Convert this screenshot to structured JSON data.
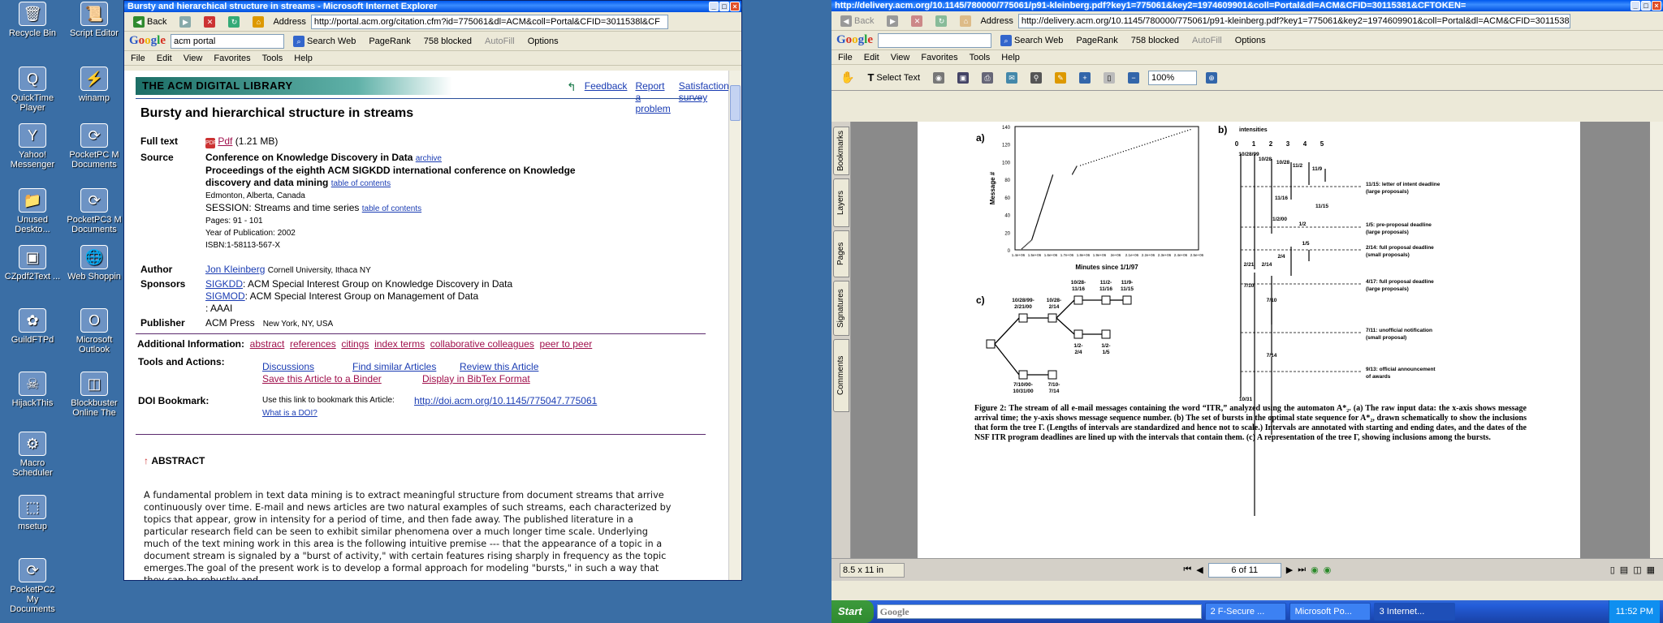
{
  "desktop_left": [
    {
      "label": "Recycle Bin",
      "glyph": "🗑"
    },
    {
      "label": "Script Editor",
      "glyph": "📜"
    },
    {
      "label": "QuickTime Player",
      "glyph": "Q"
    },
    {
      "label": "winamp",
      "glyph": "⚡"
    },
    {
      "label": "Yahoo! Messenger",
      "glyph": "Y"
    },
    {
      "label": "PocketPC M Documents",
      "glyph": "⟳"
    },
    {
      "label": "Unused Deskto...",
      "glyph": "📁"
    },
    {
      "label": "PocketPC3 M Documents",
      "glyph": "⟳"
    },
    {
      "label": "CZpdf2Text ...",
      "glyph": "▣"
    },
    {
      "label": "Web Shoppin",
      "glyph": "🌐"
    },
    {
      "label": "GuildFTPd",
      "glyph": "✿"
    },
    {
      "label": "Microsoft Outlook",
      "glyph": "O"
    },
    {
      "label": "HijackThis",
      "glyph": "☠"
    },
    {
      "label": "Blockbuster Online The",
      "glyph": "◫"
    },
    {
      "label": "Macro Scheduler",
      "glyph": "⚙"
    },
    {
      "label": "msetup",
      "glyph": "⬚"
    },
    {
      "label": "PocketPC2 My Documents",
      "glyph": "⟳"
    }
  ],
  "ie_left": {
    "title": "Bursty and hierarchical structure in streams - Microsoft Internet Explorer",
    "back": "Back",
    "address_label": "Address",
    "url": "http://portal.acm.org/citation.cfm?id=775061&dl=ACM&coll=Portal&CFID=3011538l&CF",
    "google_query": "acm portal",
    "search_web": "Search Web",
    "pagerank": "PageRank",
    "blocked": "758 blocked",
    "autofill": "AutoFill",
    "options": "Options",
    "menu": [
      "File",
      "Edit",
      "View",
      "Favorites",
      "Tools",
      "Help"
    ]
  },
  "acm": {
    "library": "THE ACM DIGITAL LIBRARY",
    "top_links": [
      "Feedback",
      "Report a problem",
      "Satisfaction survey"
    ],
    "title": "Bursty and hierarchical structure in streams",
    "fulltext_label": "Full text",
    "pdf": "Pdf",
    "pdf_size": "(1.21 MB)",
    "source_label": "Source",
    "conf": "Conference on Knowledge Discovery in Data",
    "archive": "archive",
    "proceedings": "Proceedings of the eighth ACM SIGKDD international conference on Knowledge discovery and data mining",
    "toc": "table of contents",
    "location": "Edmonton, Alberta, Canada",
    "session": "SESSION: Streams and time series",
    "pages": "Pages: 91 - 101",
    "year": "Year of Publication: 2002",
    "isbn": "ISBN:1-58113-567-X",
    "author_label": "Author",
    "author": "Jon Kleinberg",
    "affil": "Cornell University, Ithaca NY",
    "sponsors_label": "Sponsors",
    "sig1": "SIGKDD",
    "sig1_desc": ": ACM Special Interest Group on Knowledge Discovery in Data",
    "sig2": "SIGMOD",
    "sig2_desc": ": ACM Special Interest Group on Management of Data",
    "sig3": ": AAAI",
    "publisher_label": "Publisher",
    "publisher": "ACM Press",
    "pub_loc": "New York, NY, USA",
    "addinfo_label": "Additional Information:",
    "addinfo": [
      "abstract",
      "references",
      "citings",
      "index terms",
      "collaborative colleagues",
      "peer to peer"
    ],
    "tools_label": "Tools and Actions:",
    "tools": [
      "Discussions",
      "Find similar Articles",
      "Review this Article",
      "Save this Article to a Binder",
      "Display in BibTex Format"
    ],
    "doi_label": "DOI Bookmark:",
    "doi_text": "Use this link to bookmark this Article:",
    "doi_url": "http://doi.acm.org/10.1145/775047.775061",
    "doi_what": "What is a DOI?",
    "abstract_head": "ABSTRACT",
    "abstract": "A fundamental problem in text data mining is to extract meaningful structure from document streams that arrive continuously over time. E-mail and news articles are two natural examples of such streams, each characterized by topics that appear, grow in intensity for a period of time, and then fade away. The published literature in a particular research field can be seen to exhibit similar phenomena over a much longer time scale. Underlying much of the text mining work in this area is the following intuitive premise --- that the appearance of a topic in a document stream is signaled by a \"burst of activity,\" with certain features rising sharply in frequency as the topic emerges.The goal of the present work is to develop a formal approach for modeling \"bursts,\" in such a way that they can be robustly and"
  },
  "ie_right": {
    "title": "http://delivery.acm.org/10.1145/780000/775061/p91-kleinberg.pdf?key1=775061&key2=1974609901&coll=Portal&dl=ACM&CFID=30115381&CFTOKEN=",
    "back": "Back",
    "address_label": "Address",
    "url": "http://delivery.acm.org/10.1145/780000/775061/p91-kleinberg.pdf?key1=775061&key2=1974609901&coll=Portal&dl=ACM&CFID=30115381&C",
    "search_web": "Search Web",
    "pagerank": "PageRank",
    "blocked": "758 blocked",
    "autofill": "AutoFill",
    "options": "Options",
    "menu": [
      "File",
      "Edit",
      "View",
      "Favorites",
      "Tools",
      "Help"
    ],
    "select_text": "Select Text",
    "zoom": "100%",
    "side_tabs": [
      "Bookmarks",
      "Layers",
      "Pages",
      "Signatures",
      "Comments"
    ],
    "page_size": "8.5 x 11 in",
    "page_indicator": "6 of 11"
  },
  "figure": {
    "a_label": "a)",
    "b_label": "b)",
    "c_label": "c)",
    "a_ylabel": "Message #",
    "a_xlabel": "Minutes since 1/1/97",
    "a_yticks": [
      "0",
      "20",
      "40",
      "60",
      "80",
      "100",
      "120",
      "140"
    ],
    "a_xticks": [
      "1.4e+06",
      "1.5e+06",
      "1.6e+06",
      "1.7e+06",
      "1.8e+06",
      "1.9e+06",
      "2e+06",
      "2.1e+06",
      "2.2e+06",
      "2.3e+06",
      "2.4e+06",
      "2.5e+06"
    ],
    "b_title": "intensities",
    "b_levels": [
      "0",
      "1",
      "2",
      "3",
      "4",
      "5"
    ],
    "b_labels": [
      "10/28/99",
      "10/28",
      "10/28",
      "11/2",
      "11/9",
      "11/16",
      "11/15",
      "1/2/00",
      "1/2",
      "1/5",
      "2/4",
      "2/14",
      "2/21",
      "7/10",
      "7/10",
      "7/14",
      "10/31"
    ],
    "b_deadlines": [
      "11/15: letter of intent deadline",
      "(large proposals)",
      "1/5: pre-proposal deadline",
      "(large proposals)",
      "2/14: full proposal deadline",
      "(small proposals)",
      "4/17: full proposal deadline",
      "(large proposals)",
      "7/11: unofficial notification",
      "(small proposal)",
      "9/13: official announcement",
      "of awards"
    ],
    "c_nodes": [
      "10/28/99-",
      "2/21/00",
      "10/28-",
      "2/14",
      "10/28-",
      "11/16",
      "11/2-",
      "11/16",
      "11/9-",
      "11/15",
      "1/2-",
      "2/4",
      "1/2-",
      "1/5",
      "7/10/00-",
      "10/31/00",
      "7/10-",
      "7/14"
    ],
    "caption": "Figure 2: The stream of all e-mail messages containing the word “ITR,” analyzed using the automaton A*₂. (a) The raw input data: the x-axis shows message arrival time; the y-axis shows message sequence number. (b) The set of bursts in the optimal state sequence for A*₂, drawn schematically to show the inclusions that form the tree Γ. (Lengths of intervals are standardized and hence not to scale.) Intervals are annotated with starting and ending dates, and the dates of the NSF ITR program deadlines are lined up with the intervals that contain them. (c) A representation of the tree Γ, showing inclusions among the bursts."
  },
  "taskbar": {
    "start": "Start",
    "google": "Google",
    "tasks": [
      "2 F-Secure ...",
      "Microsoft Po...",
      "3 Internet..."
    ],
    "clock": "11:52 PM"
  }
}
